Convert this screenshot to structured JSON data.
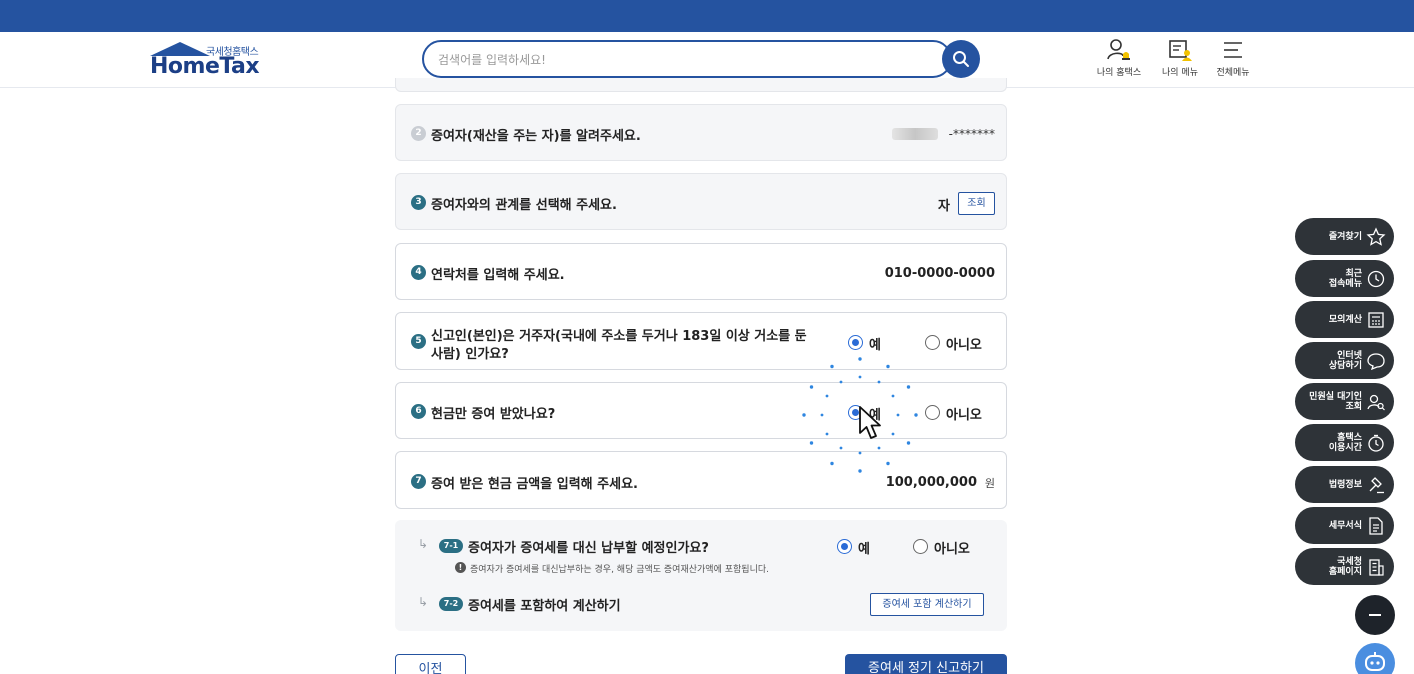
{
  "app": {
    "logo_tag": "국세청홈택스",
    "logo_text": "HomeTax"
  },
  "search": {
    "placeholder": "검색어를 입력하세요!"
  },
  "header_menu": [
    {
      "label": "나의 홈택스",
      "icon": "person-bell-icon"
    },
    {
      "label": "나의 메뉴",
      "icon": "person-list-icon"
    },
    {
      "label": "전체메뉴",
      "icon": "hamburger-icon"
    }
  ],
  "questions": {
    "q2": {
      "num": "2",
      "text": "증여자(재산을 주는 자)를 알려주세요.",
      "value": "-*******"
    },
    "q3": {
      "num": "3",
      "text": "증여자와의 관계를 선택해 주세요.",
      "value": "자",
      "button": "조회"
    },
    "q4": {
      "num": "4",
      "text": "연락처를 입력해 주세요.",
      "value": "010-0000-0000"
    },
    "q5": {
      "num": "5",
      "text_line1": "신고인(본인)은 거주자(국내에 주소를 두거나 183일 이상 거소를 둔",
      "text_line2": "사람) 인가요?",
      "yes": "예",
      "no": "아니오",
      "selected": "yes"
    },
    "q6": {
      "num": "6",
      "text": "현금만 증여 받았나요?",
      "yes": "예",
      "no": "아니오",
      "selected": "yes"
    },
    "q7": {
      "num": "7",
      "text": "증여 받은 현금 금액을 입력해 주세요.",
      "value": "100,000,000",
      "unit": "원"
    }
  },
  "sub": {
    "arrow": "↳",
    "q71": {
      "badge": "7-1",
      "text": "증여자가 증여세를 대신 납부할 예정인가요?",
      "yes": "예",
      "no": "아니오",
      "selected": "yes"
    },
    "note_icon": "!",
    "note": "증여자가 증여세를 대신납부하는 경우, 해당 금액도 증여재산가액에 포함됩니다.",
    "q72": {
      "badge": "7-2",
      "text": "증여세를 포함하여 계산하기",
      "button": "증여세 포함 계산하기"
    }
  },
  "footer": {
    "prev": "이전",
    "next": "증여세 정기 신고하기"
  },
  "sidebar": [
    {
      "label": "즐겨찾기",
      "icon": "star-icon"
    },
    {
      "label": "최근\n접속메뉴",
      "icon": "clock-icon"
    },
    {
      "label": "모의계산",
      "icon": "calculator-icon"
    },
    {
      "label": "인터넷\n상담하기",
      "icon": "chat-icon"
    },
    {
      "label": "민원실 대기인\n조회",
      "icon": "people-search-icon"
    },
    {
      "label": "홈택스\n이용시간",
      "icon": "timer-icon"
    },
    {
      "label": "법령정보",
      "icon": "gavel-icon"
    },
    {
      "label": "세무서식",
      "icon": "document-icon"
    },
    {
      "label": "국세청\n홈페이지",
      "icon": "building-icon"
    }
  ],
  "colors": {
    "brand": "#2553a0",
    "accent": "#2a6bd6",
    "badge": "#2b6f84",
    "side": "#2e3338",
    "chatbot": "#4a8ee0"
  }
}
